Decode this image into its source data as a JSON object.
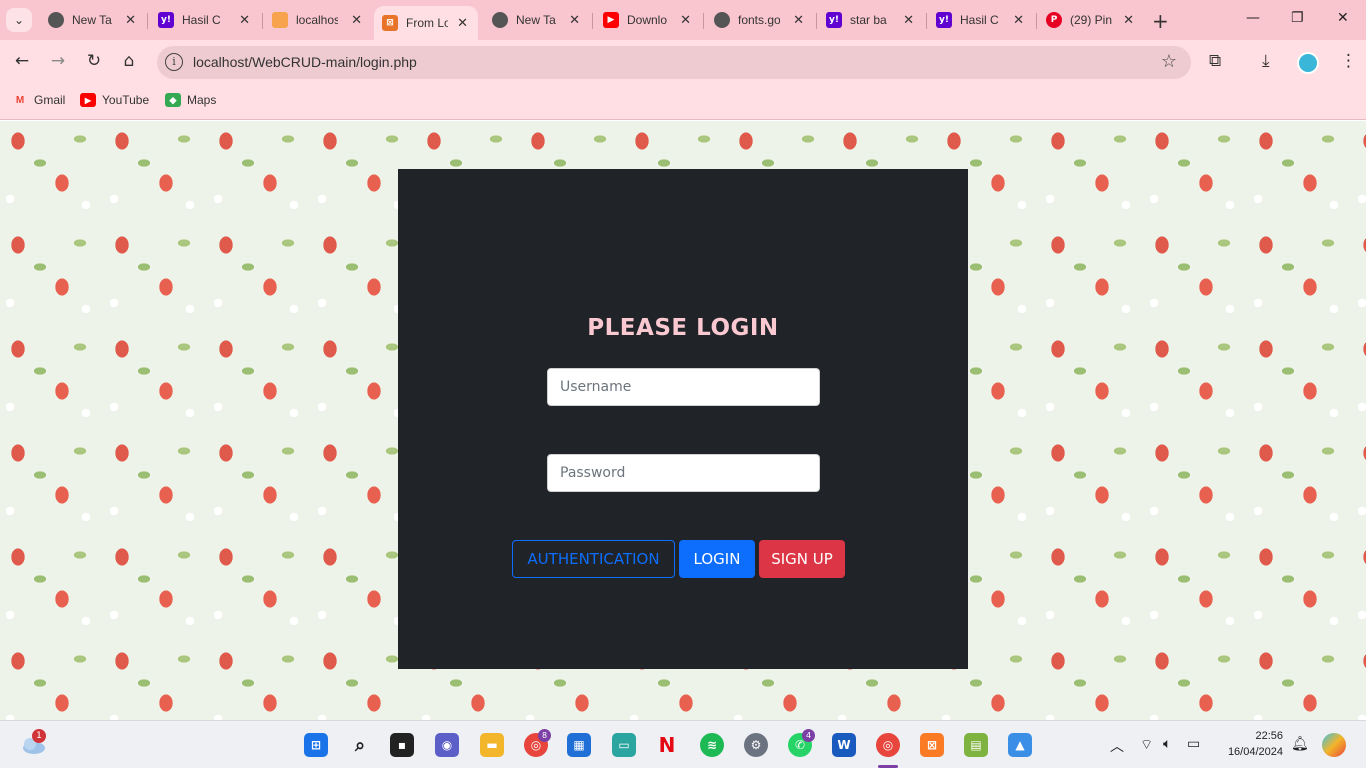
{
  "browser": {
    "tabs": [
      {
        "title": "New Ta",
        "icon": "globe-icon"
      },
      {
        "title": "Hasil C",
        "icon": "yahoo-icon"
      },
      {
        "title": "localhos",
        "icon": "phpmyadmin-icon"
      },
      {
        "title": "From Lo",
        "icon": "xampp-icon"
      },
      {
        "title": "New Ta",
        "icon": "globe-icon"
      },
      {
        "title": "Downlo",
        "icon": "youtube-icon"
      },
      {
        "title": "fonts.go",
        "icon": "globe-icon"
      },
      {
        "title": "star ba",
        "icon": "yahoo-icon"
      },
      {
        "title": "Hasil C",
        "icon": "yahoo-icon"
      },
      {
        "title": "(29) Pin",
        "icon": "pinterest-icon"
      }
    ],
    "address": "localhost/WebCRUD-main/login.php",
    "bookmarks": [
      {
        "label": "Gmail",
        "icon": "gmail-icon"
      },
      {
        "label": "YouTube",
        "icon": "youtube-icon"
      },
      {
        "label": "Maps",
        "icon": "maps-icon"
      }
    ]
  },
  "login": {
    "title": "PLEASE LOGIN",
    "username_placeholder": "Username",
    "password_placeholder": "Password",
    "auth_label": "AUTHENTICATION",
    "login_label": "LOGIN",
    "signup_label": "SIGN UP"
  },
  "taskbar": {
    "weather_badge": "1",
    "time": "22:56",
    "date": "16/04/2024",
    "chrome_badge": "8",
    "whatsapp_badge": "4"
  },
  "colors": {
    "panel_bg": "#202328",
    "title_color": "#f9c8d0",
    "primary": "#0d6efd",
    "danger": "#dc3545",
    "chrome_tint": "#f9c6cf"
  }
}
